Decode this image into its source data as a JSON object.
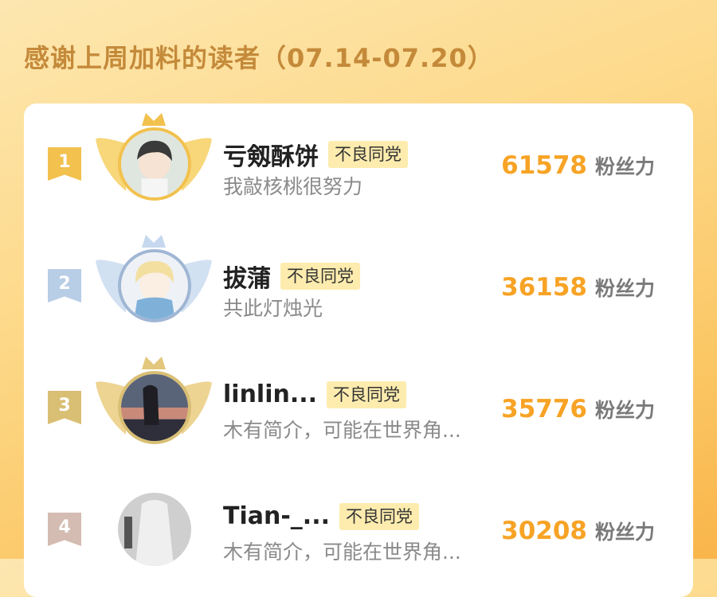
{
  "header": {
    "title": "感谢上周加料的读者（07.14-07.20）"
  },
  "colors": {
    "gold": "#f2c14e",
    "silver": "#b8cde6",
    "bronze": "#d9bf74",
    "rank4": "#d4bcb2",
    "score": "#f7a325",
    "tag_bg": "#fdecae"
  },
  "ranking": [
    {
      "rank": "1",
      "name": "亏剱酥饼",
      "tag": "不良同党",
      "bio": "我敲核桃很努力",
      "score": "61578",
      "unit": "粉丝力",
      "frame": "gold-wings"
    },
    {
      "rank": "2",
      "name": "拔蒲",
      "tag": "不良同党",
      "bio": "共此灯烛光",
      "score": "36158",
      "unit": "粉丝力",
      "frame": "silver-wings"
    },
    {
      "rank": "3",
      "name": "linlin...",
      "tag": "不良同党",
      "bio": "木有简介，可能在世界角...",
      "score": "35776",
      "unit": "粉丝力",
      "frame": "bronze-wings"
    },
    {
      "rank": "4",
      "name": "Tian-_...",
      "tag": "不良同党",
      "bio": "木有简介，可能在世界角...",
      "score": "30208",
      "unit": "粉丝力",
      "frame": "none"
    }
  ]
}
